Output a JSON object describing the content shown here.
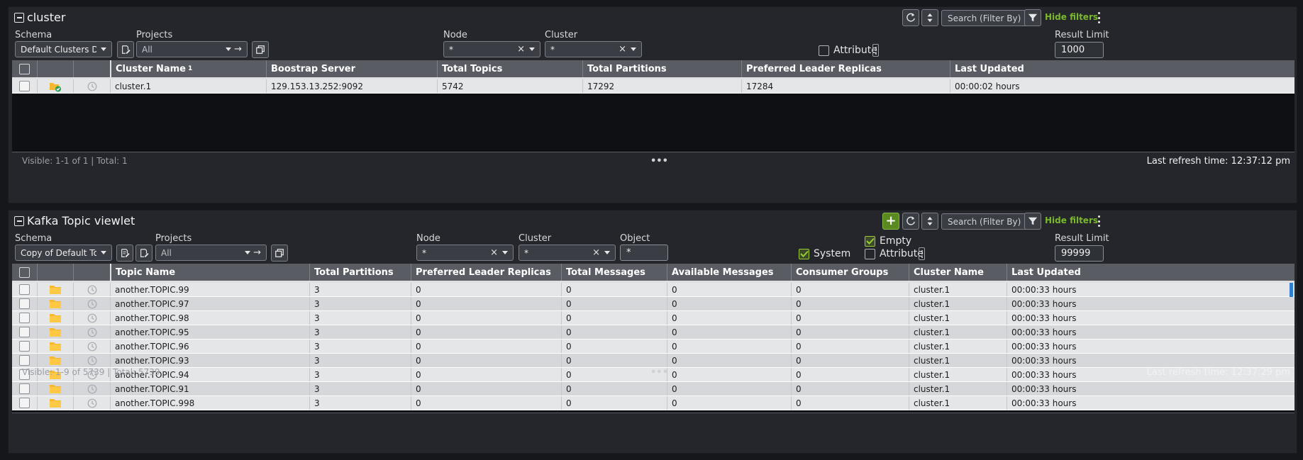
{
  "panel1": {
    "title": "cluster",
    "search_placeholder": "Search (Filter By)",
    "hide_filters": "Hide filters",
    "schema_label": "Schema",
    "schema_value": "Default Clusters Dir",
    "projects_label": "Projects",
    "projects_value": "All",
    "node_label": "Node",
    "node_value": "*",
    "cluster_label": "Cluster",
    "cluster_value": "*",
    "attribute_label": "Attribute",
    "result_limit_label": "Result Limit",
    "result_limit_value": "1000",
    "columns": [
      "Cluster Name",
      "Boostrap Server",
      "Total Topics",
      "Total Partitions",
      "Preferred Leader Replicas",
      "Last Updated"
    ],
    "sort_marker": "1",
    "rows": [
      [
        "cluster.1",
        "129.153.13.252:9092",
        "5742",
        "17292",
        "17284",
        "00:00:02 hours"
      ]
    ],
    "visible_text": "Visible: 1-1 of 1 | Total: 1",
    "dots": "•••",
    "refresh_text": "Last refresh time: 12:37:12 pm"
  },
  "panel2": {
    "title": "Kafka Topic viewlet",
    "search_placeholder": "Search (Filter By)",
    "hide_filters": "Hide filters",
    "schema_label": "Schema",
    "schema_value": "Copy of Default Topic",
    "projects_label": "Projects",
    "projects_value": "All",
    "node_label": "Node",
    "node_value": "*",
    "cluster_label": "Cluster",
    "cluster_value": "*",
    "object_label": "Object",
    "object_value": "*",
    "system_label": "System",
    "empty_label": "Empty",
    "attribute_label": "Attribute",
    "system_checked": true,
    "empty_checked": true,
    "attribute_checked": false,
    "result_limit_label": "Result Limit",
    "result_limit_value": "99999",
    "columns": [
      "Topic Name",
      "Total Partitions",
      "Preferred Leader Replicas",
      "Total Messages",
      "Available Messages",
      "Consumer Groups",
      "Cluster Name",
      "Last Updated"
    ],
    "rows": [
      [
        "another.TOPIC.99",
        "3",
        "0",
        "0",
        "0",
        "0",
        "cluster.1",
        "00:00:33 hours"
      ],
      [
        "another.TOPIC.97",
        "3",
        "0",
        "0",
        "0",
        "0",
        "cluster.1",
        "00:00:33 hours"
      ],
      [
        "another.TOPIC.98",
        "3",
        "0",
        "0",
        "0",
        "0",
        "cluster.1",
        "00:00:33 hours"
      ],
      [
        "another.TOPIC.95",
        "3",
        "0",
        "0",
        "0",
        "0",
        "cluster.1",
        "00:00:33 hours"
      ],
      [
        "another.TOPIC.96",
        "3",
        "0",
        "0",
        "0",
        "0",
        "cluster.1",
        "00:00:33 hours"
      ],
      [
        "another.TOPIC.93",
        "3",
        "0",
        "0",
        "0",
        "0",
        "cluster.1",
        "00:00:33 hours"
      ],
      [
        "another.TOPIC.94",
        "3",
        "0",
        "0",
        "0",
        "0",
        "cluster.1",
        "00:00:33 hours"
      ],
      [
        "another.TOPIC.91",
        "3",
        "0",
        "0",
        "0",
        "0",
        "cluster.1",
        "00:00:33 hours"
      ],
      [
        "another.TOPIC.998",
        "3",
        "0",
        "0",
        "0",
        "0",
        "cluster.1",
        "00:00:33 hours"
      ]
    ],
    "visible_text": "Visible: 1-9 of 5739 | Total: 5739",
    "dots": "•••",
    "refresh_text": "Last refresh time: 12:37:29 pm"
  },
  "icons": {
    "collapse": "collapse-square-icon",
    "refresh": "refresh-icon",
    "sort": "sort-arrows-icon",
    "filter": "filter-funnel-icon",
    "menu": "kebab-menu-icon",
    "schema_edit": "schema-edit-icon",
    "copy": "copy-icon",
    "add": "plus-icon",
    "cluster_ok": "folder-check-icon",
    "topic": "folder-icon",
    "history": "clock-icon"
  },
  "colors": {
    "accent_green": "#7ab82e",
    "folder_yellow": "#f5b82e",
    "panel_bg": "#24262b",
    "header_bg": "#595c63"
  }
}
